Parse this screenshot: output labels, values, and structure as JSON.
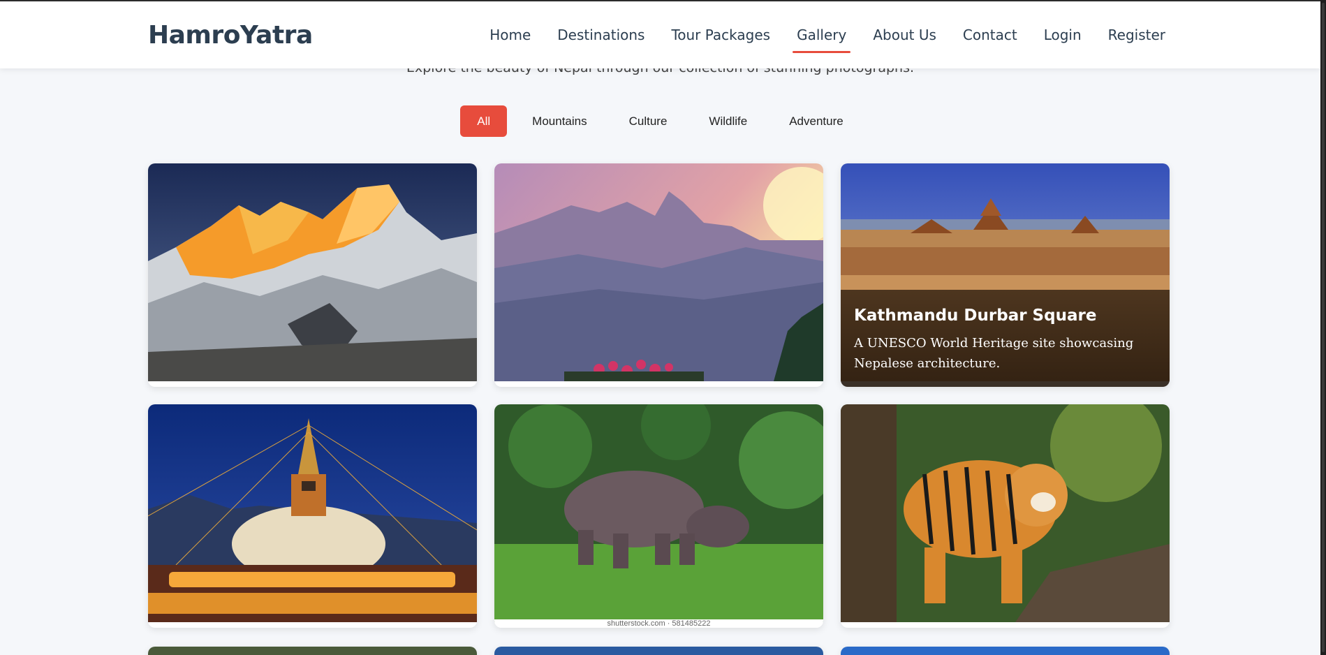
{
  "header": {
    "logo": "HamroYatra",
    "nav": [
      {
        "label": "Home"
      },
      {
        "label": "Destinations"
      },
      {
        "label": "Tour Packages"
      },
      {
        "label": "Gallery",
        "active": true
      },
      {
        "label": "About Us"
      },
      {
        "label": "Contact"
      },
      {
        "label": "Login"
      },
      {
        "label": "Register"
      }
    ]
  },
  "gallery": {
    "subtitle": "Explore the beauty of Nepal through our collection of stunning photographs.",
    "filters": [
      "All",
      "Mountains",
      "Culture",
      "Wildlife",
      "Adventure"
    ],
    "active_filter": "All",
    "cards": [
      {
        "image": "everest-sunset"
      },
      {
        "image": "annapurna-dawn"
      },
      {
        "image": "durbar-square",
        "title": "Kathmandu Durbar Square",
        "description": "A UNESCO World Heritage site showcasing Nepalese architecture."
      },
      {
        "image": "boudhanath-stupa"
      },
      {
        "image": "one-horned-rhino",
        "watermark": "shutterstock.com · 581485222"
      },
      {
        "image": "bengal-tiger"
      }
    ]
  },
  "colors": {
    "accent": "#e74c3c",
    "text": "#2c3e50",
    "background": "#f5f7fa"
  }
}
